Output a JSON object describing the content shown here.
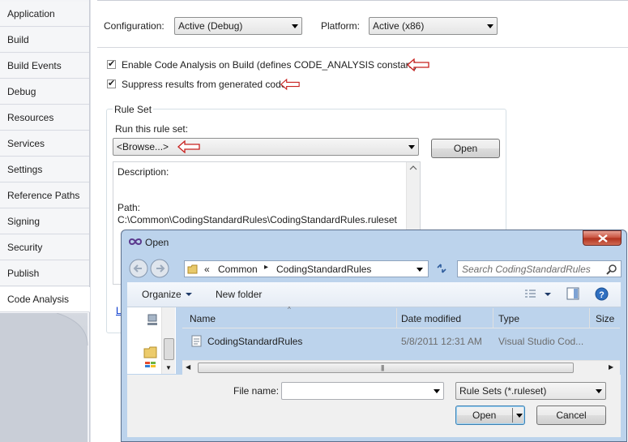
{
  "sidebar": {
    "items": [
      {
        "label": "Application"
      },
      {
        "label": "Build"
      },
      {
        "label": "Build Events"
      },
      {
        "label": "Debug"
      },
      {
        "label": "Resources"
      },
      {
        "label": "Services"
      },
      {
        "label": "Settings"
      },
      {
        "label": "Reference Paths"
      },
      {
        "label": "Signing"
      },
      {
        "label": "Security"
      },
      {
        "label": "Publish"
      },
      {
        "label": "Code Analysis"
      }
    ],
    "selected": "Code Analysis"
  },
  "config": {
    "configuration_label": "Configuration:",
    "configuration_value": "Active (Debug)",
    "platform_label": "Platform:",
    "platform_value": "Active (x86)"
  },
  "options": {
    "enable_label": "Enable Code Analysis on Build (defines CODE_ANALYSIS constant)",
    "enable_checked": true,
    "suppress_label": "Suppress results from generated code",
    "suppress_checked": true
  },
  "ruleset": {
    "group_label": "Rule Set",
    "run_label": "Run this rule set:",
    "selected": "<Browse...>",
    "open_button": "Open",
    "description_label": "Description:",
    "path_label": "Path:",
    "path_value": "C:\\Common\\CodingStandardRules\\CodingStandardRules.ruleset",
    "link_fragment": "L"
  },
  "dialog": {
    "title": "Open",
    "breadcrumb": {
      "prefix": "«",
      "parts": [
        "Common",
        "CodingStandardRules"
      ]
    },
    "search_placeholder": "Search CodingStandardRules",
    "toolbar": {
      "organize": "Organize",
      "new_folder": "New folder"
    },
    "columns": [
      "Name",
      "Date modified",
      "Type",
      "Size"
    ],
    "rows": [
      {
        "name": "CodingStandardRules",
        "date": "5/8/2011 12:31 AM",
        "type": "Visual Studio Cod..."
      }
    ],
    "filename_label": "File name:",
    "filename_value": "",
    "filter_value": "Rule Sets (*.ruleset)",
    "open_button": "Open",
    "cancel_button": "Cancel"
  },
  "colors": {
    "annotation_arrow": "#c8201e",
    "dialog_frame": "#bcd3ec",
    "link": "#0033cc"
  }
}
